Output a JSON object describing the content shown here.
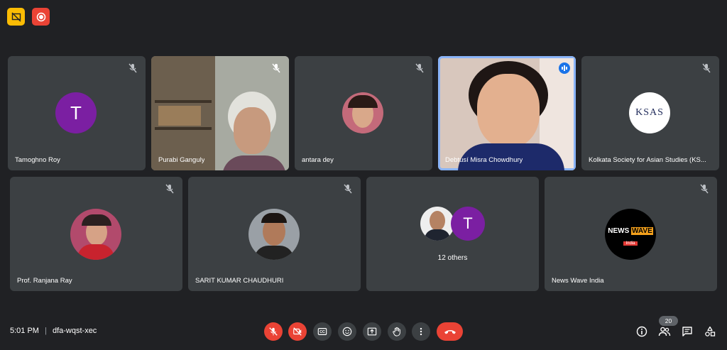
{
  "meeting": {
    "time": "5:01 PM",
    "separator": "|",
    "code": "dfa-wqst-xec",
    "participant_count": "20"
  },
  "tiles": [
    {
      "name": "Tamoghno Roy",
      "avatar_letter": "T"
    },
    {
      "name": "Purabi Ganguly"
    },
    {
      "name": "antara dey"
    },
    {
      "name": "Debtusí Misra Chowdhury"
    },
    {
      "name": "Kolkata Society for Asian Studies (KS...",
      "logo_text": "KSAS"
    },
    {
      "name": "Prof. Ranjana Ray"
    },
    {
      "name": "SARIT KUMAR CHAUDHURI"
    },
    {
      "name": "12 others",
      "avatar_letter": "T"
    },
    {
      "name": "News Wave India",
      "logo_top": "NEWS",
      "logo_mid": "WAVE",
      "logo_sub": "India"
    }
  ],
  "colors": {
    "background": "#202124",
    "tile": "#3c4043",
    "accent": "#8ab4f8",
    "danger": "#ea4335",
    "warning": "#fbbc04",
    "avatar_purple": "#7b1fa2"
  }
}
